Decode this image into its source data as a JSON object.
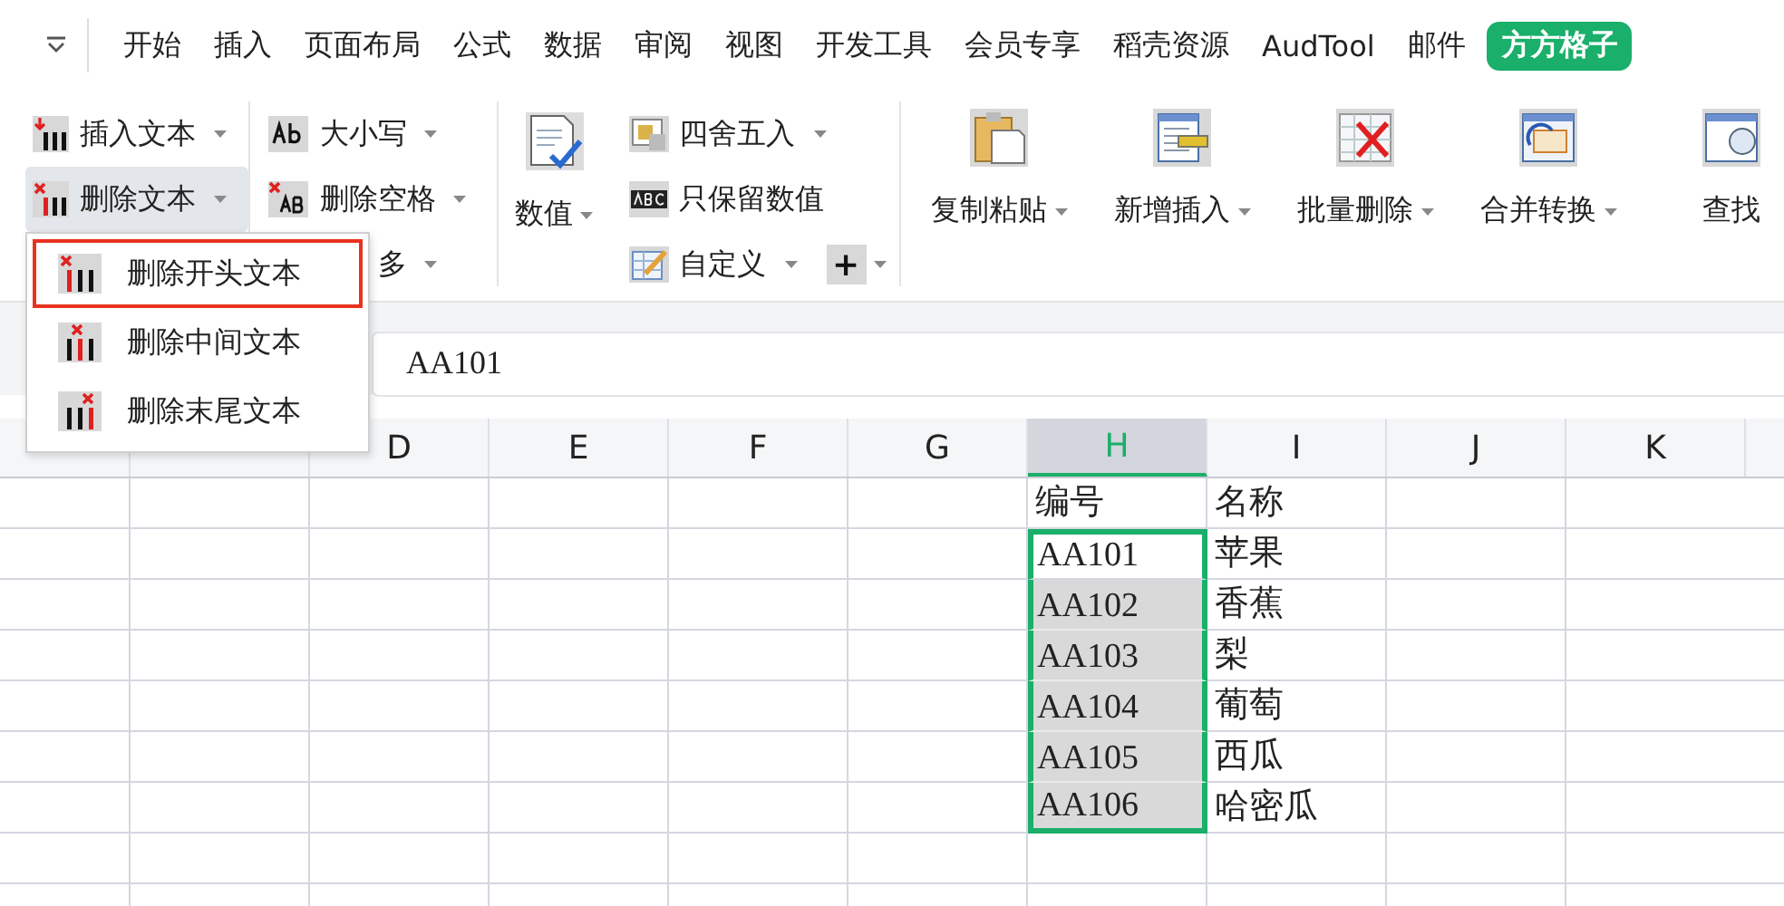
{
  "menu_bar": {
    "items": [
      {
        "label": "开始",
        "selected": false
      },
      {
        "label": "插入",
        "selected": false
      },
      {
        "label": "页面布局",
        "selected": false
      },
      {
        "label": "公式",
        "selected": false
      },
      {
        "label": "数据",
        "selected": false
      },
      {
        "label": "审阅",
        "selected": false
      },
      {
        "label": "视图",
        "selected": false
      },
      {
        "label": "开发工具",
        "selected": false
      },
      {
        "label": "会员专享",
        "selected": false
      },
      {
        "label": "稻壳资源",
        "selected": false
      },
      {
        "label": "AudTool",
        "selected": false
      },
      {
        "label": "邮件",
        "selected": false
      },
      {
        "label": "方方格子",
        "selected": true
      }
    ]
  },
  "ribbon": {
    "text_column": [
      {
        "label": "插入文本",
        "dropdown": true,
        "selected": false
      },
      {
        "label": "删除文本",
        "dropdown": true,
        "selected": true
      }
    ],
    "case_column": [
      {
        "label": "大小写",
        "dropdown": true,
        "kind": "icon"
      },
      {
        "label": "删除空格",
        "dropdown": true,
        "kind": "icon"
      },
      {
        "label": "多",
        "dropdown": true,
        "kind": "text"
      }
    ],
    "number_button": {
      "label": "数值",
      "dropdown": true
    },
    "number_column": [
      {
        "label": "四舍五入",
        "dropdown": true
      },
      {
        "label": "只保留数值",
        "dropdown": false
      },
      {
        "label": "自定义",
        "dropdown": true
      }
    ],
    "plus_button": {
      "label": "+",
      "dropdown": true
    },
    "big_buttons": [
      {
        "label": "复制粘贴",
        "dropdown": true
      },
      {
        "label": "新增插入",
        "dropdown": true
      },
      {
        "label": "批量删除",
        "dropdown": true
      },
      {
        "label": "合并转换",
        "dropdown": true
      },
      {
        "label": "查找",
        "dropdown": false
      }
    ]
  },
  "dropdown_menu": {
    "items": [
      {
        "label": "删除开头文本",
        "selected": true
      },
      {
        "label": "删除中间文本",
        "selected": false
      },
      {
        "label": "删除末尾文本",
        "selected": false
      }
    ]
  },
  "formula_bar": {
    "value": "AA101"
  },
  "sheet": {
    "columns": [
      {
        "label": "D",
        "selected": false
      },
      {
        "label": "E",
        "selected": false
      },
      {
        "label": "F",
        "selected": false
      },
      {
        "label": "G",
        "selected": false
      },
      {
        "label": "H",
        "selected": true
      },
      {
        "label": "I",
        "selected": false
      },
      {
        "label": "J",
        "selected": false
      },
      {
        "label": "K",
        "selected": false
      }
    ],
    "rows": [
      {
        "h": "编号",
        "i": "名称",
        "selected": false,
        "shaded": false
      },
      {
        "h": "AA101",
        "i": "苹果",
        "selected": true,
        "shaded": false
      },
      {
        "h": "AA102",
        "i": "香蕉",
        "selected": true,
        "shaded": true
      },
      {
        "h": "AA103",
        "i": "梨",
        "selected": true,
        "shaded": true
      },
      {
        "h": "AA104",
        "i": "葡萄",
        "selected": true,
        "shaded": true
      },
      {
        "h": "AA105",
        "i": "西瓜",
        "selected": true,
        "shaded": true
      },
      {
        "h": "AA106",
        "i": "哈密瓜",
        "selected": true,
        "shaded": true
      }
    ]
  }
}
